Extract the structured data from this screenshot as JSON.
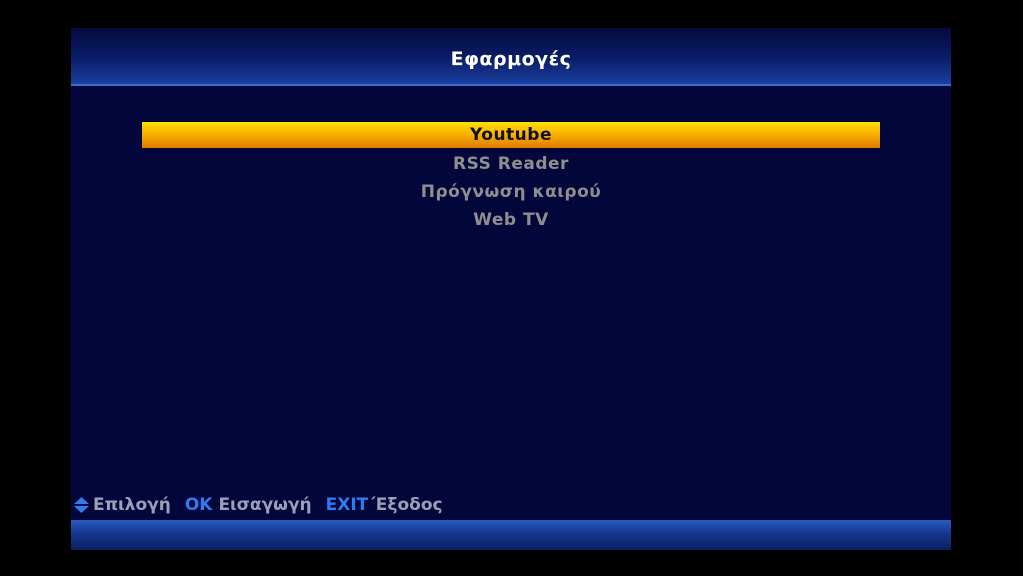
{
  "header": {
    "title": "Εφαρμογές"
  },
  "menu": {
    "items": [
      {
        "label": "Youtube",
        "selected": true
      },
      {
        "label": "RSS Reader",
        "selected": false
      },
      {
        "label": "Πρόγνωση καιρού",
        "selected": false
      },
      {
        "label": "Web TV",
        "selected": false
      }
    ]
  },
  "footer": {
    "nav_icon": "up-down-arrows-icon",
    "select_label": "Επιλογή",
    "ok_key": "OK",
    "enter_label": "Εισαγωγή",
    "exit_key": "EXIT",
    "exit_label": "΄Εξοδος"
  },
  "colors": {
    "background": "#000000",
    "panel": "#03063a",
    "selection": "#f8b400",
    "key_blue": "#2f7cf0",
    "text_gray": "#8e8e8e"
  }
}
